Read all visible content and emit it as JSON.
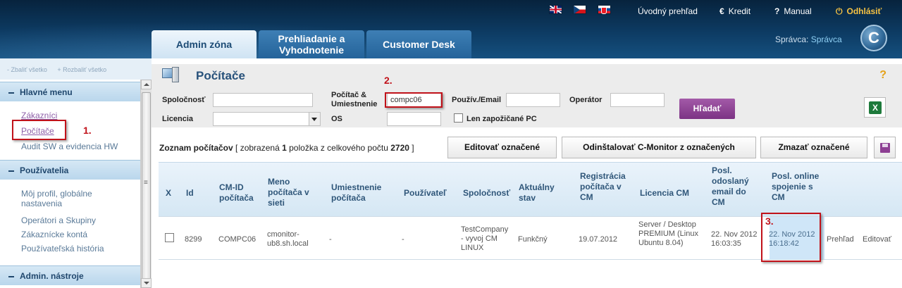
{
  "topbar": {
    "languages": [
      "UK flag",
      "CZ flag",
      "SK flag"
    ],
    "links": {
      "home": "Úvodný prehľad",
      "credit": "Kredit",
      "manual": "Manual",
      "logout": "Odhlásiť"
    }
  },
  "tabs": [
    {
      "label": "Admin zóna"
    },
    {
      "label": "Prehliadanie a Vyhodnotenie"
    },
    {
      "label": "Customer Desk"
    }
  ],
  "admin": {
    "label": "Správca:",
    "value": "Správca"
  },
  "logo": "C",
  "sidebar": {
    "collapse_all": "- Zbaliť všetko",
    "expand_all": "+ Rozbaliť všetko",
    "sections": [
      {
        "title": "Hlavné menu",
        "items": [
          "Zákazníci",
          "Počítače",
          "Audit SW a evidencia HW"
        ]
      },
      {
        "title": "Používatelia",
        "items": [
          "Môj profil, globálne nastavenia",
          "Operátori a Skupiny",
          "Zákaznícke kontá",
          "Používateľská história"
        ]
      },
      {
        "title": "Admin. nástroje",
        "items": []
      }
    ]
  },
  "page": {
    "title": "Počítače",
    "help": "?"
  },
  "filter": {
    "company_label": "Spoločnosť",
    "computer_label": "Počítač & Umiestnenie",
    "computer_value": "compc06",
    "user_label": "Použív./Email",
    "operator_label": "Operátor",
    "license_label": "Licencia",
    "os_label": "OS",
    "loaned_label": "Len zapožičané PC",
    "search_button": "Hľadať"
  },
  "list": {
    "prefix": "Zoznam počítačov",
    "info_a": "[ zobrazená",
    "shown": "1",
    "info_b": "položka z celkového počtu",
    "total": "2720",
    "info_c": "]",
    "edit_selected": "Editovať označené",
    "uninstall_selected": "Odinštalovať C-Monitor z označených",
    "delete_selected": "Zmazať označené"
  },
  "table": {
    "headers": {
      "x": "X",
      "id": "Id",
      "cmid": "CM-ID počítača",
      "name": "Meno počítača v sieti",
      "location": "Umiestnenie počítača",
      "user": "Používateľ",
      "company": "Spoločnosť",
      "state": "Aktuálny stav",
      "registration": "Registrácia počítača v CM",
      "license": "Licencia CM",
      "last_email": "Posl. odoslaný email do CM",
      "last_online": "Posl. online spojenie s CM"
    },
    "rows": [
      {
        "id": "8299",
        "cmid": "COMPC06",
        "name": "cmonitor-ub8.sh.local",
        "location": "-",
        "user": "-",
        "company": "TestCompany - vyvoj CM LINUX",
        "state": "Funkčný",
        "registration": "19.07.2012",
        "license": "Server / Desktop PREMIUM (Linux Ubuntu 8.04)",
        "last_email": "22. Nov 2012 16:03:35",
        "last_online": "22. Nov 2012 16:18:42",
        "action_view": "Prehľad",
        "action_edit": "Editovať"
      }
    ]
  },
  "annotations": [
    "1.",
    "2.",
    "3."
  ],
  "colors": {
    "accent": "#7c3384",
    "header": "#0d3b63",
    "annotation": "#c1121a"
  }
}
